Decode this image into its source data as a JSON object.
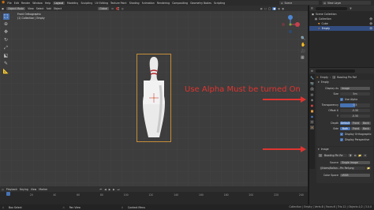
{
  "topbar": {
    "menus": [
      "File",
      "Edit",
      "Render",
      "Window",
      "Help"
    ],
    "workspaces": [
      "Layout",
      "Modeling",
      "Sculpting",
      "UV Editing",
      "Texture Paint",
      "Shading",
      "Animation",
      "Rendering",
      "Compositing",
      "Geometry Nodes",
      "Scripting"
    ],
    "active_workspace": "Layout",
    "scene": "Scene",
    "view_layer": "View Layer"
  },
  "viewport_header": {
    "mode": "Object Mode",
    "menus": [
      "View",
      "Select",
      "Add",
      "Object"
    ],
    "transform": "Global"
  },
  "viewport": {
    "view_name": "Front Orthographic",
    "context": "(1) Collection | Empty"
  },
  "annotation": {
    "text": "Use Alpha Must be turned On",
    "color": "#e0342f"
  },
  "outliner": {
    "root": "Scene Collection",
    "items": [
      {
        "label": "Collection",
        "icon": "collection-icon"
      },
      {
        "label": "Cube",
        "icon": "mesh-icon"
      },
      {
        "label": "Empty",
        "icon": "empty-icon"
      }
    ]
  },
  "properties": {
    "breadcrumb_object": "Empty",
    "breadcrumb_data": "Bowling Pin Ref",
    "empty_panel": {
      "title": "Empty",
      "display_as_label": "Display As",
      "display_as_value": "Image",
      "size_label": "Size",
      "size_value": "5m",
      "use_alpha_label": "Use Alpha",
      "transparency_label": "Transparency",
      "transparency_value": "0.5",
      "offset_x_label": "Offset X",
      "offset_x_value": "-0.50",
      "offset_y_label": "Y",
      "offset_y_value": "-0.50",
      "depth_label": "Depth",
      "depth_options": [
        "Default",
        "Front",
        "Back"
      ],
      "side_label": "Side",
      "side_options": [
        "Both",
        "Front",
        "Back"
      ],
      "show_ortho_label": "Display Orthographic",
      "show_persp_label": "Display Perspective"
    },
    "image_panel": {
      "title": "Image",
      "image_name": "Bowling Pin Re",
      "source_label": "Source",
      "source_value": "Single Image",
      "filepath": "//Users/Kollan...Pin Ref.png",
      "color_space_label": "Color Space",
      "color_space_value": "sRGB"
    }
  },
  "timeline": {
    "menus": [
      "Playback",
      "Keying",
      "View",
      "Marker"
    ],
    "ruler": [
      "0",
      "20",
      "40",
      "60",
      "80",
      "100",
      "120",
      "140",
      "160",
      "180",
      "200",
      "220",
      "240"
    ]
  },
  "statusbar": {
    "left": "Box Select",
    "middle1": "Pan View",
    "middle2": "Context Menu",
    "right": "Collection | Empty | Verts:8 | Faces:6 | Tris:12 | Objects:1/2 | 3.0.0"
  }
}
